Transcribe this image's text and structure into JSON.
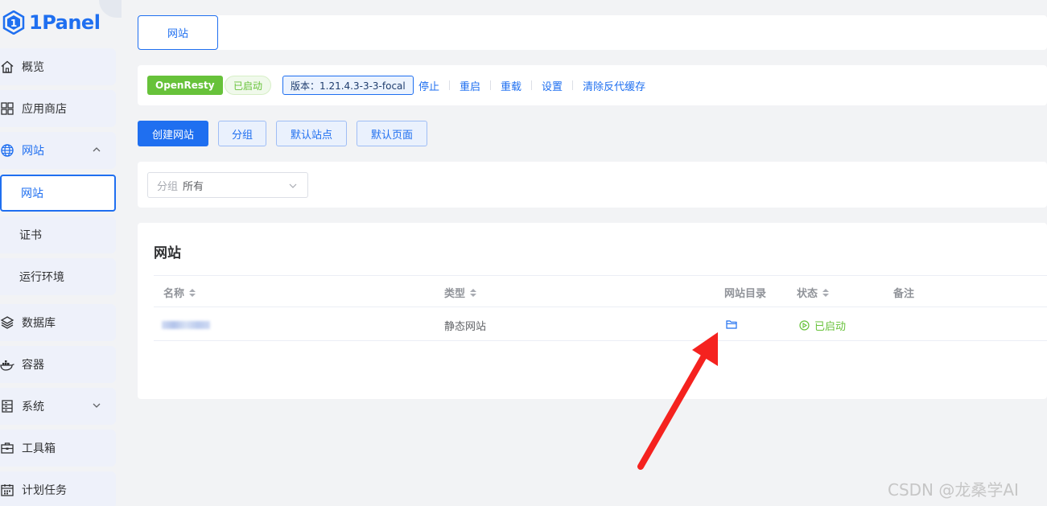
{
  "app": {
    "logo_text": "1Panel"
  },
  "sidebar": {
    "items": [
      {
        "label": "概览",
        "icon": "home-icon"
      },
      {
        "label": "应用商店",
        "icon": "grid-icon"
      },
      {
        "label": "网站",
        "icon": "globe-icon",
        "expanded": true
      },
      {
        "label": "网站",
        "sub": true,
        "active": true
      },
      {
        "label": "证书",
        "sub": true
      },
      {
        "label": "运行环境",
        "sub": true
      },
      {
        "label": "数据库",
        "icon": "layers-icon"
      },
      {
        "label": "容器",
        "icon": "docker-icon"
      },
      {
        "label": "系统",
        "icon": "server-icon"
      },
      {
        "label": "工具箱",
        "icon": "toolbox-icon"
      },
      {
        "label": "计划任务",
        "icon": "calendar-icon"
      }
    ]
  },
  "tabs": {
    "active": "网站"
  },
  "status_bar": {
    "app_name": "OpenResty",
    "state": "已启动",
    "version": "版本：1.21.4.3-3-3-focal",
    "actions": [
      "停止",
      "重启",
      "重载",
      "设置",
      "清除反代缓存"
    ]
  },
  "toolbar": {
    "create": "创建网站",
    "group": "分组",
    "default_site": "默认站点",
    "default_page": "默认页面"
  },
  "filter": {
    "label": "分组",
    "value": "所有"
  },
  "table": {
    "title": "网站",
    "columns": [
      "名称",
      "类型",
      "网站目录",
      "状态",
      "备注"
    ],
    "rows": [
      {
        "name": "",
        "type": "静态网站",
        "dir_icon": "folder-icon",
        "status": "已启动",
        "remark": ""
      }
    ]
  },
  "watermark": "CSDN @龙桑学AI",
  "colors": {
    "primary": "#1f6ff0",
    "success": "#67c23a",
    "annotation_arrow": "#f5221f"
  }
}
